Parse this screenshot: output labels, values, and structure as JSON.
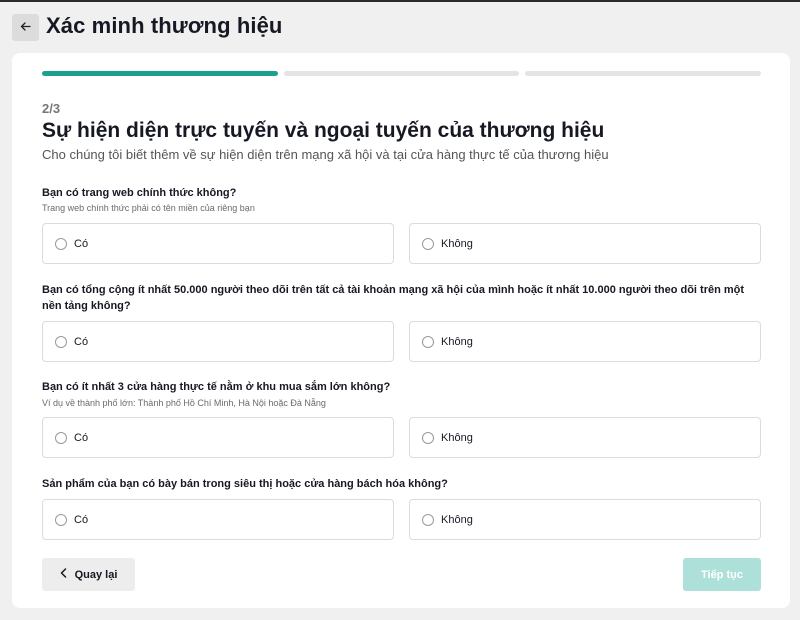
{
  "header": {
    "title": "Xác minh thương hiệu",
    "back_icon": "arrow-left-icon"
  },
  "progress": {
    "total_steps": 3,
    "current_step": 1
  },
  "step_label": "2/3",
  "section": {
    "title": "Sự hiện diện trực tuyến và ngoại tuyến của thương hiệu",
    "subtitle": "Cho chúng tôi biết thêm về sự hiện diện trên mạng xã hội và tại cửa hàng thực tế của thương hiệu"
  },
  "questions": [
    {
      "text": "Bạn có trang web chính thức không?",
      "hint": "Trang web chính thức phải có tên miền của riêng bạn",
      "options": [
        "Có",
        "Không"
      ]
    },
    {
      "text": "Bạn có tổng cộng ít nhất 50.000 người theo dõi trên tất cả tài khoản mạng xã hội của mình hoặc ít nhất 10.000 người theo dõi trên một nền tảng không?",
      "hint": "",
      "options": [
        "Có",
        "Không"
      ]
    },
    {
      "text": "Bạn có ít nhất 3 cửa hàng thực tế nằm ở khu mua sắm lớn không?",
      "hint": "Ví dụ về thành phố lớn: Thành phố Hồ Chí Minh, Hà Nội hoặc Đà Nẵng",
      "options": [
        "Có",
        "Không"
      ]
    },
    {
      "text": "Sản phẩm của bạn có bày bán trong siêu thị hoặc cửa hàng bách hóa không?",
      "hint": "",
      "options": [
        "Có",
        "Không"
      ]
    }
  ],
  "footer": {
    "back_label": "Quay lại",
    "back_icon": "chevron-left-icon",
    "next_label": "Tiếp tục",
    "next_enabled": false
  },
  "colors": {
    "accent": "#1c9f8f",
    "accent_disabled": "#aee0da"
  }
}
